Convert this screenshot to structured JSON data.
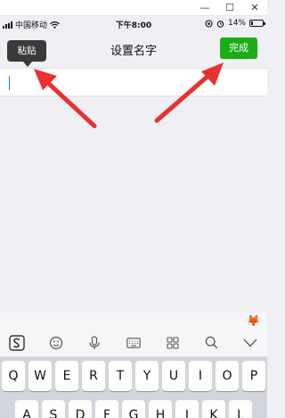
{
  "window": {
    "minimize_glyph": "—",
    "maximize_glyph": "☐",
    "close_glyph": "✕"
  },
  "status_bar": {
    "carrier": "中国移动",
    "time": "下午8:00",
    "battery_text": "14%",
    "battery_level": 0.14
  },
  "navbar": {
    "title": "设置名字",
    "done_label": "完成"
  },
  "tooltip": {
    "paste_label": "粘贴"
  },
  "name_input": {
    "value": ""
  },
  "keyboard": {
    "toolbar_icons": [
      "sogou-logo-icon",
      "emoji-face-icon",
      "microphone-icon",
      "keyboard-icon",
      "grid-icon",
      "search-icon",
      "collapse-icon"
    ],
    "row1": [
      "Q",
      "W",
      "E",
      "R",
      "T",
      "Y",
      "U",
      "I",
      "O",
      "P"
    ],
    "row2": [
      "A",
      "S",
      "D",
      "F",
      "G",
      "H",
      "J",
      "K",
      "L"
    ]
  },
  "colors": {
    "accent_green": "#1aad19",
    "arrow_red": "#e8312f",
    "tooltip_bg": "#3a3a3a"
  }
}
